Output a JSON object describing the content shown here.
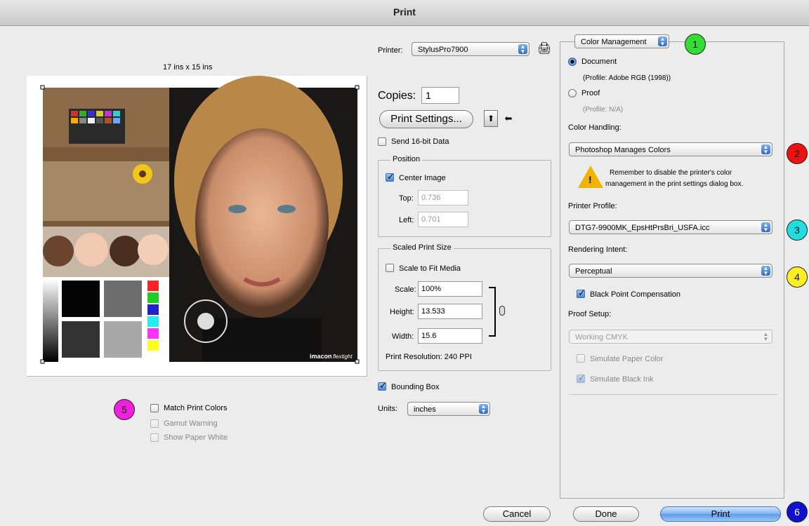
{
  "window": {
    "title": "Print"
  },
  "preview": {
    "size_label": "17 ins x 15 ins",
    "photo_credit": "imacon",
    "photo_credit2": "flextight"
  },
  "printer": {
    "label": "Printer:",
    "value": "StylusPro7900"
  },
  "copies": {
    "label": "Copies:",
    "value": "1"
  },
  "print_settings": {
    "label": "Print Settings..."
  },
  "send16bit": {
    "label": "Send 16-bit Data",
    "checked": false
  },
  "position": {
    "title": "Position",
    "center_image": {
      "label": "Center Image",
      "checked": true
    },
    "top": {
      "label": "Top:",
      "value": "0.736"
    },
    "left": {
      "label": "Left:",
      "value": "0.701"
    }
  },
  "scaled_size": {
    "title": "Scaled Print Size",
    "scale_to_fit": {
      "label": "Scale to Fit Media",
      "checked": false
    },
    "scale": {
      "label": "Scale:",
      "value": "100%"
    },
    "height": {
      "label": "Height:",
      "value": "13.533"
    },
    "width": {
      "label": "Width:",
      "value": "15.6"
    },
    "resolution": "Print Resolution: 240 PPI"
  },
  "bounding_box": {
    "label": "Bounding Box",
    "checked": true
  },
  "units": {
    "label": "Units:",
    "value": "inches"
  },
  "match": {
    "match_print_colors": {
      "label": "Match Print Colors",
      "checked": false
    },
    "gamut_warning": {
      "label": "Gamut Warning",
      "checked": false
    },
    "show_paper_white": {
      "label": "Show Paper White",
      "checked": false
    }
  },
  "color_management": {
    "section_popup": "Color Management",
    "document": {
      "label": "Document",
      "profile": "(Profile: Adobe RGB (1998))"
    },
    "proof": {
      "label": "Proof",
      "profile": "(Profile: N/A)"
    },
    "color_handling_label": "Color Handling:",
    "color_handling_value": "Photoshop Manages Colors",
    "warning_text_line1": "Remember to disable the printer's color",
    "warning_text_line2": "management in the print settings dialog box.",
    "printer_profile_label": "Printer Profile:",
    "printer_profile_value": "DTG7-9900MK_EpsHtPrsBri_USFA.icc",
    "rendering_intent_label": "Rendering Intent:",
    "rendering_intent_value": "Perceptual",
    "black_point": {
      "label": "Black Point Compensation",
      "checked": true
    },
    "proof_setup_label": "Proof Setup:",
    "proof_setup_value": "Working CMYK",
    "simulate_paper": {
      "label": "Simulate Paper Color"
    },
    "simulate_black": {
      "label": "Simulate Black Ink"
    }
  },
  "buttons": {
    "cancel": "Cancel",
    "done": "Done",
    "print": "Print"
  },
  "badges": {
    "b1": "1",
    "b2": "2",
    "b3": "3",
    "b4": "4",
    "b5": "5",
    "b6": "6",
    "colors": {
      "b1": "#33dd33",
      "b2": "#ee1111",
      "b3": "#22dddd",
      "b4": "#ffee22",
      "b5": "#ee22dd",
      "b6": "#1111cc"
    }
  }
}
